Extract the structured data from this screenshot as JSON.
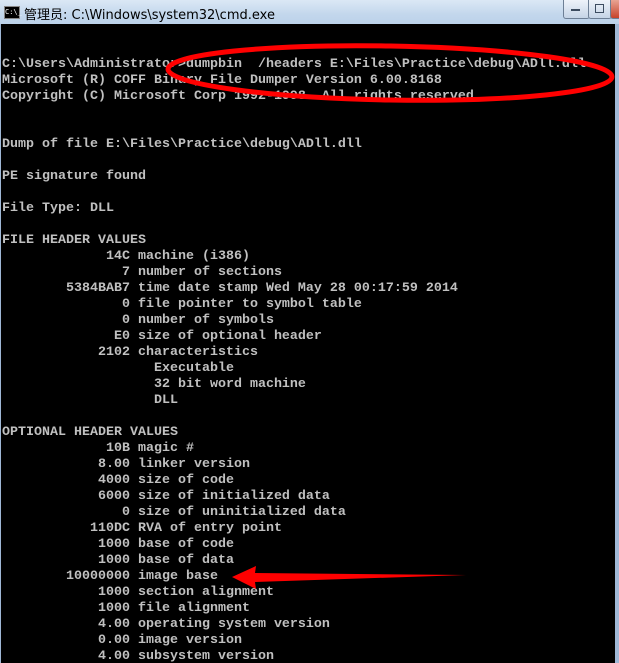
{
  "window": {
    "title": "管理员: C:\\Windows\\system32\\cmd.exe",
    "icon": "cmd-icon",
    "icon_text": "C:\\_"
  },
  "annotation_color": "#ff0000",
  "console_lines": [
    "",
    "",
    "C:\\Users\\Administrator>dumpbin  /headers E:\\Files\\Practice\\debug\\ADll.dll",
    "Microsoft (R) COFF Binary File Dumper Version 6.00.8168",
    "Copyright (C) Microsoft Corp 1992-1998. All rights reserved.",
    "",
    "",
    "Dump of file E:\\Files\\Practice\\debug\\ADll.dll",
    "",
    "PE signature found",
    "",
    "File Type: DLL",
    "",
    "FILE HEADER VALUES",
    "             14C machine (i386)",
    "               7 number of sections",
    "        5384BAB7 time date stamp Wed May 28 00:17:59 2014",
    "               0 file pointer to symbol table",
    "               0 number of symbols",
    "              E0 size of optional header",
    "            2102 characteristics",
    "                   Executable",
    "                   32 bit word machine",
    "                   DLL",
    "",
    "OPTIONAL HEADER VALUES",
    "             10B magic #",
    "            8.00 linker version",
    "            4000 size of code",
    "            6000 size of initialized data",
    "               0 size of uninitialized data",
    "           110DC RVA of entry point",
    "            1000 base of code",
    "            1000 base of data",
    "        10000000 image base",
    "            1000 section alignment",
    "            1000 file alignment",
    "            4.00 operating system version",
    "            0.00 image version",
    "            4.00 subsystem version"
  ]
}
